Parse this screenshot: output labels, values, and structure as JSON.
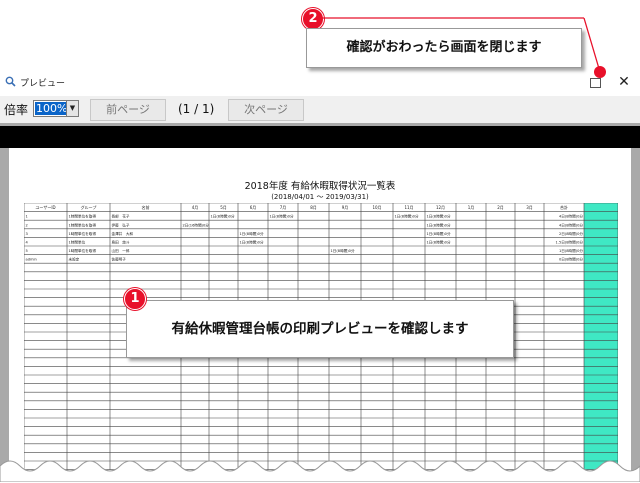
{
  "window": {
    "title": "プレビュー",
    "close_glyph": "✕"
  },
  "toolbar": {
    "zoom_label": "倍率",
    "zoom_value": "100%",
    "prev_label": "前ページ",
    "page_indicator": "(1 / 1)",
    "next_label": "次ページ"
  },
  "report": {
    "title": "2018年度 有給休暇取得状況一覧表",
    "period": "(2018/04/01 ～ 2019/03/31)",
    "headers": [
      "ユーザーID",
      "グループ",
      "名前",
      "4月",
      "5月",
      "6月",
      "7月",
      "8月",
      "9月",
      "10月",
      "11月",
      "12月",
      "1月",
      "2月",
      "3月",
      "合計"
    ],
    "rows": [
      [
        "1",
        "1時間単位を取得",
        "長部　花子",
        "",
        "1日(8時間)0分",
        "",
        "1日(8時間)0分",
        "",
        "",
        "",
        "1日(8時間)0分",
        "1日(8時間)0分",
        "",
        "",
        "",
        "4日(8時間)0分"
      ],
      [
        "2",
        "1時間単位を取得",
        "伊藤　弘子",
        "2日(16時間)0分",
        "",
        "",
        "",
        "",
        "",
        "",
        "",
        "1日(8時間)0分",
        "",
        "",
        "",
        "4日(8時間)0分"
      ],
      [
        "3",
        "1時間単位を取得",
        "金澤井　大和",
        "",
        "",
        "1日(8時間)0分",
        "",
        "",
        "",
        "",
        "",
        "1日(8時間)0分",
        "",
        "",
        "",
        "2日(8時間)0分"
      ],
      [
        "4",
        "1時間単位",
        "島田　悠斗",
        "",
        "",
        "1日(8時間)0分",
        "",
        "",
        "",
        "",
        "",
        "1日(8時間)0分",
        "",
        "",
        "",
        "1.5日(8時間)0分"
      ],
      [
        "5",
        "1時間単位を取得",
        "山田　一郎",
        "",
        "",
        "",
        "",
        "",
        "1日(8時間)0分",
        "",
        "",
        "",
        "",
        "",
        "",
        "1日(8時間)0分"
      ],
      [
        "admin",
        "未設定",
        "佐藤明子",
        "",
        "",
        "",
        "",
        "",
        "",
        "",
        "",
        "",
        "",
        "",
        "",
        "0日(8時間)0分"
      ]
    ]
  },
  "callouts": {
    "one": {
      "number": "1",
      "text": "有給休暇管理台帳の印刷プレビューを確認します"
    },
    "two": {
      "number": "2",
      "text": "確認がおわったら画面を閉じます"
    }
  },
  "colors": {
    "accent": "#e8102a",
    "total_column": "#3fe8c4",
    "selection": "#0a64c8"
  }
}
